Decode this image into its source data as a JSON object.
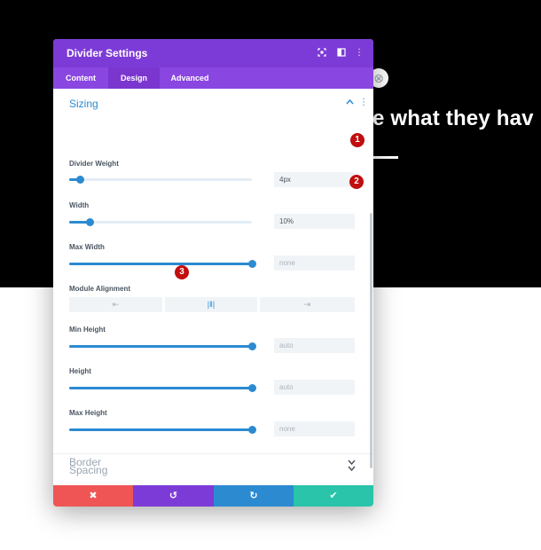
{
  "background": {
    "headline": "e what they hav",
    "colors": {
      "top": "#000000",
      "bottom": "#ffffff"
    },
    "circle_icon": "close-circle-icon"
  },
  "modal": {
    "title": "Divider Settings",
    "header_icons": [
      "expand-icon",
      "split-view-icon",
      "more-vertical-icon"
    ],
    "tabs": [
      {
        "label": "Content",
        "active": false
      },
      {
        "label": "Design",
        "active": true
      },
      {
        "label": "Advanced",
        "active": false
      }
    ],
    "colors": {
      "header": "#7c3bd6",
      "tabs": "#8a46e0",
      "accent": "#2c8ad1"
    }
  },
  "sizing": {
    "title": "Sizing",
    "fields": {
      "divider_weight": {
        "label": "Divider Weight",
        "value": "4px",
        "slider_fraction": 0.06
      },
      "width": {
        "label": "Width",
        "value": "10%",
        "slider_fraction": 0.11
      },
      "max_width": {
        "label": "Max Width",
        "placeholder": "none",
        "slider_fraction": 1.0
      },
      "min_height": {
        "label": "Min Height",
        "placeholder": "auto",
        "slider_fraction": 1.0
      },
      "height": {
        "label": "Height",
        "placeholder": "auto",
        "slider_fraction": 1.0
      },
      "max_height": {
        "label": "Max Height",
        "placeholder": "none",
        "slider_fraction": 1.0
      }
    },
    "module_alignment": {
      "label": "Module Alignment",
      "options": [
        {
          "icon": "align-left-icon",
          "glyph": "⇤",
          "active": false
        },
        {
          "icon": "align-center-icon",
          "glyph": "|‖|",
          "active": true
        },
        {
          "icon": "align-right-icon",
          "glyph": "⇥",
          "active": false
        }
      ]
    }
  },
  "collapsed_sections": [
    {
      "title": "Spacing"
    },
    {
      "title": "Border"
    }
  ],
  "badges": [
    "1",
    "2",
    "3"
  ],
  "footer": {
    "buttons": [
      {
        "name": "cancel",
        "glyph": "✖",
        "color": "#ef5555"
      },
      {
        "name": "undo",
        "glyph": "↺",
        "color": "#7c3bd6"
      },
      {
        "name": "redo",
        "glyph": "↻",
        "color": "#2c8ad1"
      },
      {
        "name": "save",
        "glyph": "✔",
        "color": "#29c4a9"
      }
    ]
  }
}
